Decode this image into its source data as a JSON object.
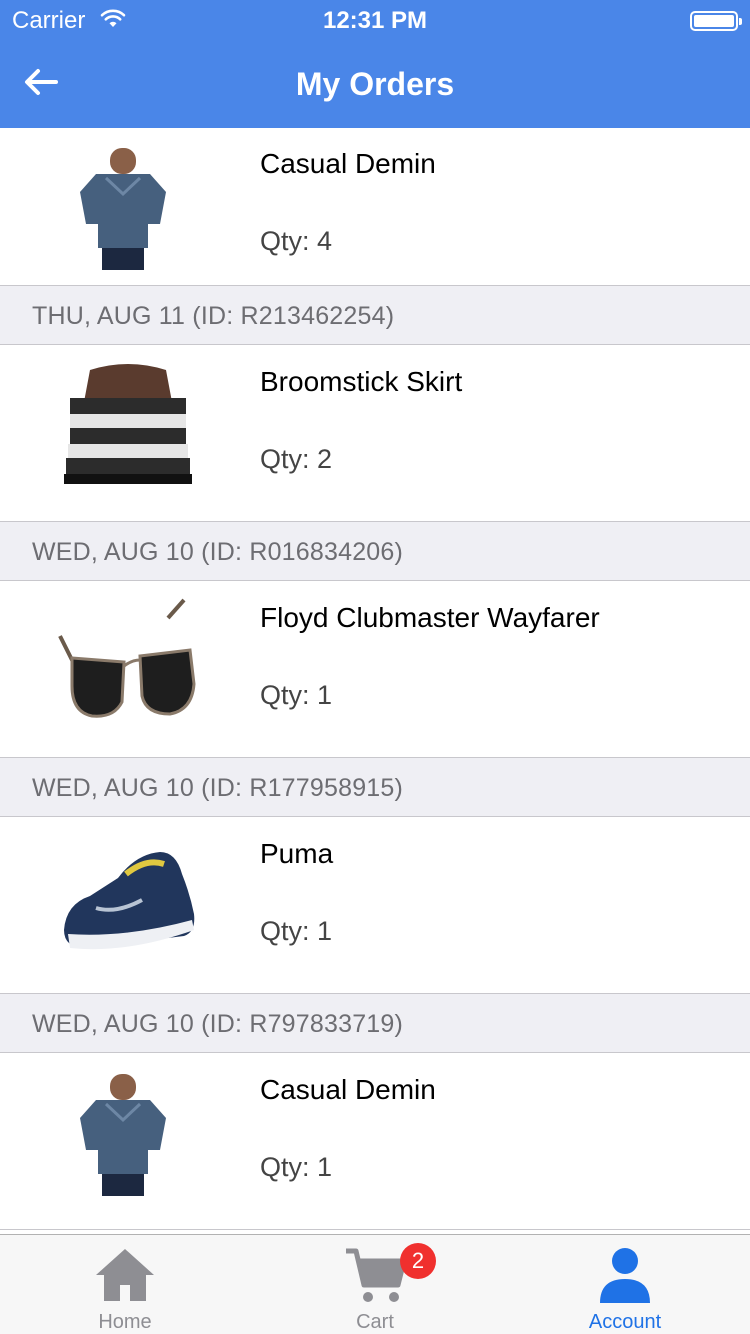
{
  "status_bar": {
    "carrier": "Carrier",
    "time": "12:31 PM"
  },
  "nav": {
    "title": "My Orders"
  },
  "orders": [
    {
      "product": "Casual Demin",
      "qty": "Qty: 4"
    },
    {
      "date_header": "THU, AUG 11 (ID: R213462254)",
      "product": "Broomstick Skirt",
      "qty": "Qty: 2"
    },
    {
      "date_header": "WED, AUG 10 (ID: R016834206)",
      "product": "Floyd Clubmaster Wayfarer",
      "qty": "Qty: 1"
    },
    {
      "date_header": "WED, AUG 10 (ID: R177958915)",
      "product": "Puma",
      "qty": "Qty: 1"
    },
    {
      "date_header": "WED, AUG 10 (ID: R797833719)",
      "product": "Casual Demin",
      "qty": "Qty: 1"
    }
  ],
  "tabbar": {
    "home": "Home",
    "cart": "Cart",
    "cart_badge": "2",
    "account": "Account",
    "active": "Account"
  },
  "colors": {
    "accent": "#4a86e8",
    "active_tab": "#1f72e6",
    "badge": "#f0302e",
    "section_bg": "#efeff4"
  }
}
